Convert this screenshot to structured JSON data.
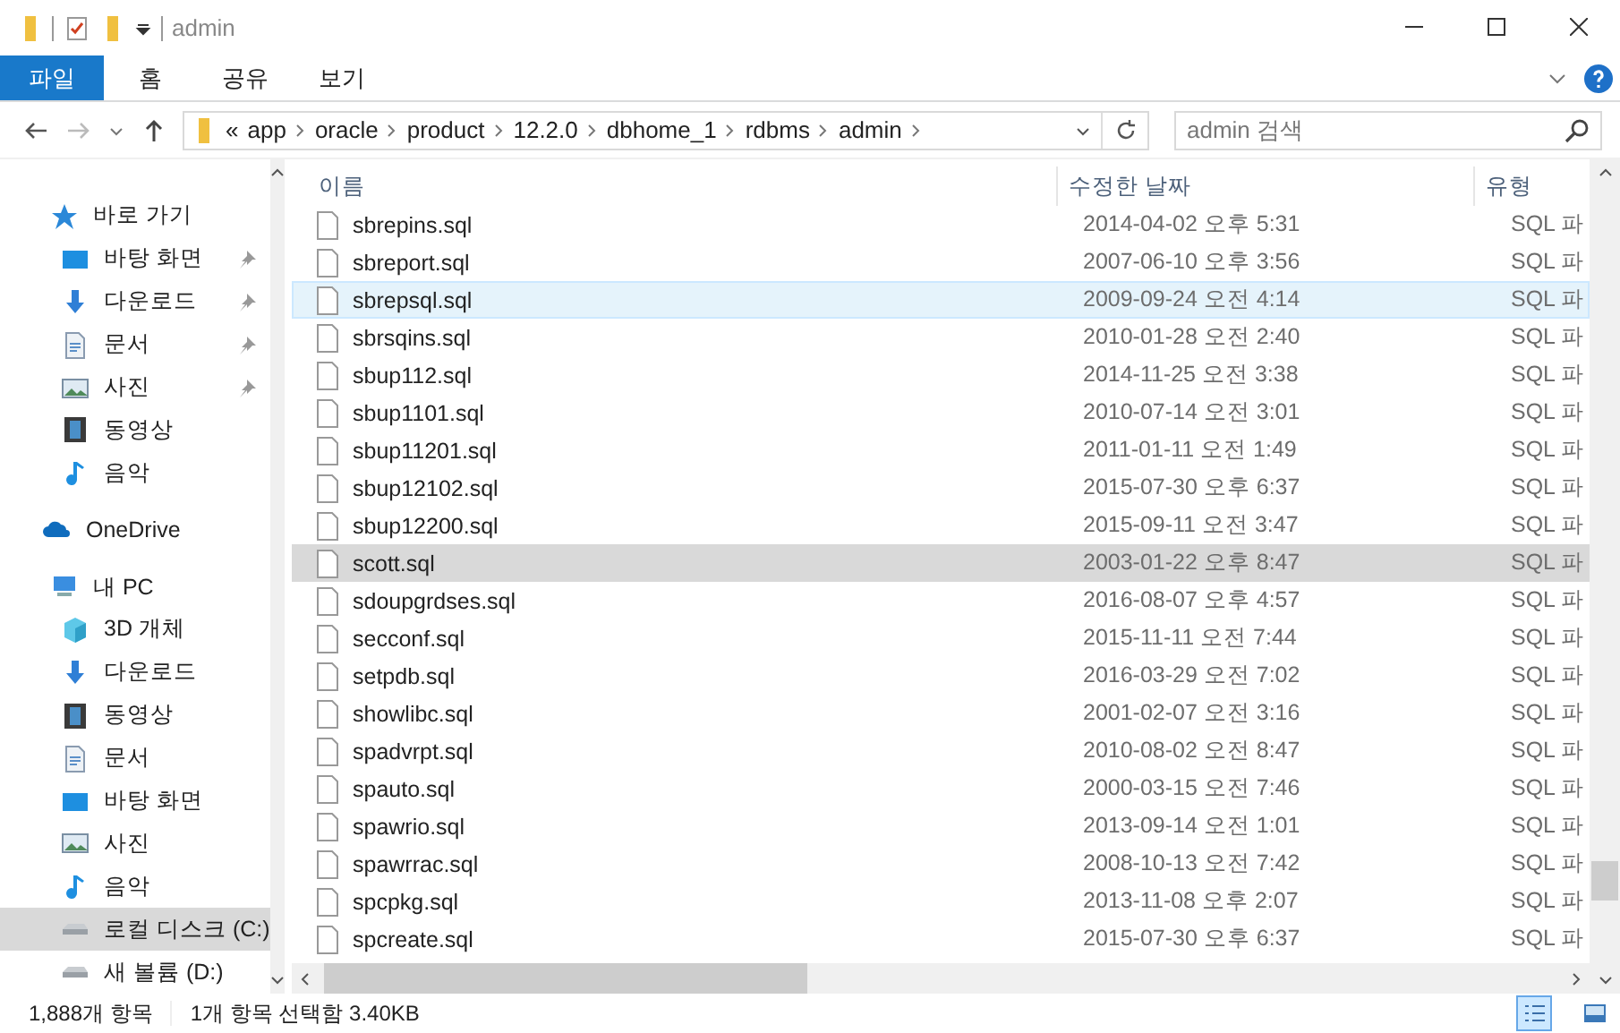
{
  "window": {
    "title": "admin"
  },
  "ribbon": {
    "tabs": [
      {
        "label": "파일",
        "selected": true
      },
      {
        "label": "홈",
        "selected": false
      },
      {
        "label": "공유",
        "selected": false
      },
      {
        "label": "보기",
        "selected": false
      }
    ]
  },
  "address": {
    "overflow": "«",
    "segments": [
      "app",
      "oracle",
      "product",
      "12.2.0",
      "dbhome_1",
      "rdbms",
      "admin"
    ]
  },
  "search": {
    "placeholder": "admin 검색"
  },
  "sidebar": {
    "items": [
      {
        "label": "바로 가기",
        "kind": "star",
        "selected": false,
        "children": [
          {
            "label": "바탕 화면",
            "kind": "desktop",
            "pinned": true,
            "selected": false
          },
          {
            "label": "다운로드",
            "kind": "download",
            "pinned": true,
            "selected": false
          },
          {
            "label": "문서",
            "kind": "document",
            "pinned": true,
            "selected": false
          },
          {
            "label": "사진",
            "kind": "pictures",
            "pinned": true,
            "selected": false
          },
          {
            "label": "동영상",
            "kind": "video",
            "pinned": false,
            "selected": false
          },
          {
            "label": "음악",
            "kind": "music",
            "pinned": false,
            "selected": false
          }
        ]
      },
      {
        "label": "OneDrive",
        "kind": "cloud",
        "selected": false
      },
      {
        "label": "내 PC",
        "kind": "pc",
        "selected": false,
        "children": [
          {
            "label": "3D 개체",
            "kind": "cube",
            "pinned": false,
            "selected": false
          },
          {
            "label": "다운로드",
            "kind": "download",
            "pinned": false,
            "selected": false
          },
          {
            "label": "동영상",
            "kind": "video",
            "pinned": false,
            "selected": false
          },
          {
            "label": "문서",
            "kind": "document",
            "pinned": false,
            "selected": false
          },
          {
            "label": "바탕 화면",
            "kind": "desktop",
            "pinned": false,
            "selected": false
          },
          {
            "label": "사진",
            "kind": "pictures",
            "pinned": false,
            "selected": false
          },
          {
            "label": "음악",
            "kind": "music",
            "pinned": false,
            "selected": false
          },
          {
            "label": "로컬 디스크 (C:)",
            "kind": "drive",
            "pinned": false,
            "selected": true
          },
          {
            "label": "새 볼륨 (D:)",
            "kind": "drive",
            "pinned": false,
            "selected": false
          }
        ]
      }
    ]
  },
  "table": {
    "columns": [
      "이름",
      "수정한 날짜",
      "유형"
    ],
    "rows": [
      {
        "name": "sbrepins.sql",
        "date": "2014-04-02 오후 5:31",
        "type": "SQL 파",
        "selected": false,
        "hovered": false
      },
      {
        "name": "sbreport.sql",
        "date": "2007-06-10 오후 3:56",
        "type": "SQL 파",
        "selected": false,
        "hovered": false
      },
      {
        "name": "sbrepsql.sql",
        "date": "2009-09-24 오전 4:14",
        "type": "SQL 파",
        "selected": false,
        "hovered": true
      },
      {
        "name": "sbrsqins.sql",
        "date": "2010-01-28 오전 2:40",
        "type": "SQL 파",
        "selected": false,
        "hovered": false
      },
      {
        "name": "sbup112.sql",
        "date": "2014-11-25 오전 3:38",
        "type": "SQL 파",
        "selected": false,
        "hovered": false
      },
      {
        "name": "sbup1101.sql",
        "date": "2010-07-14 오전 3:01",
        "type": "SQL 파",
        "selected": false,
        "hovered": false
      },
      {
        "name": "sbup11201.sql",
        "date": "2011-01-11 오전 1:49",
        "type": "SQL 파",
        "selected": false,
        "hovered": false
      },
      {
        "name": "sbup12102.sql",
        "date": "2015-07-30 오후 6:37",
        "type": "SQL 파",
        "selected": false,
        "hovered": false
      },
      {
        "name": "sbup12200.sql",
        "date": "2015-09-11 오전 3:47",
        "type": "SQL 파",
        "selected": false,
        "hovered": false
      },
      {
        "name": "scott.sql",
        "date": "2003-01-22 오후 8:47",
        "type": "SQL 파",
        "selected": true,
        "hovered": false
      },
      {
        "name": "sdoupgrdses.sql",
        "date": "2016-08-07 오후 4:57",
        "type": "SQL 파",
        "selected": false,
        "hovered": false
      },
      {
        "name": "secconf.sql",
        "date": "2015-11-11 오전 7:44",
        "type": "SQL 파",
        "selected": false,
        "hovered": false
      },
      {
        "name": "setpdb.sql",
        "date": "2016-03-29 오전 7:02",
        "type": "SQL 파",
        "selected": false,
        "hovered": false
      },
      {
        "name": "showlibc.sql",
        "date": "2001-02-07 오전 3:16",
        "type": "SQL 파",
        "selected": false,
        "hovered": false
      },
      {
        "name": "spadvrpt.sql",
        "date": "2010-08-02 오전 8:47",
        "type": "SQL 파",
        "selected": false,
        "hovered": false
      },
      {
        "name": "spauto.sql",
        "date": "2000-03-15 오전 7:46",
        "type": "SQL 파",
        "selected": false,
        "hovered": false
      },
      {
        "name": "spawrio.sql",
        "date": "2013-09-14 오전 1:01",
        "type": "SQL 파",
        "selected": false,
        "hovered": false
      },
      {
        "name": "spawrrac.sql",
        "date": "2008-10-13 오전 7:42",
        "type": "SQL 파",
        "selected": false,
        "hovered": false
      },
      {
        "name": "spcpkg.sql",
        "date": "2013-11-08 오후 2:07",
        "type": "SQL 파",
        "selected": false,
        "hovered": false
      },
      {
        "name": "spcreate.sql",
        "date": "2015-07-30 오후 6:37",
        "type": "SQL 파",
        "selected": false,
        "hovered": false
      }
    ]
  },
  "status_bar": {
    "item_count": "1,888개 항목",
    "selection": "1개 항목 선택함 3.40KB",
    "views": [
      {
        "kind": "details",
        "selected": true
      },
      {
        "kind": "large",
        "selected": false
      }
    ]
  }
}
